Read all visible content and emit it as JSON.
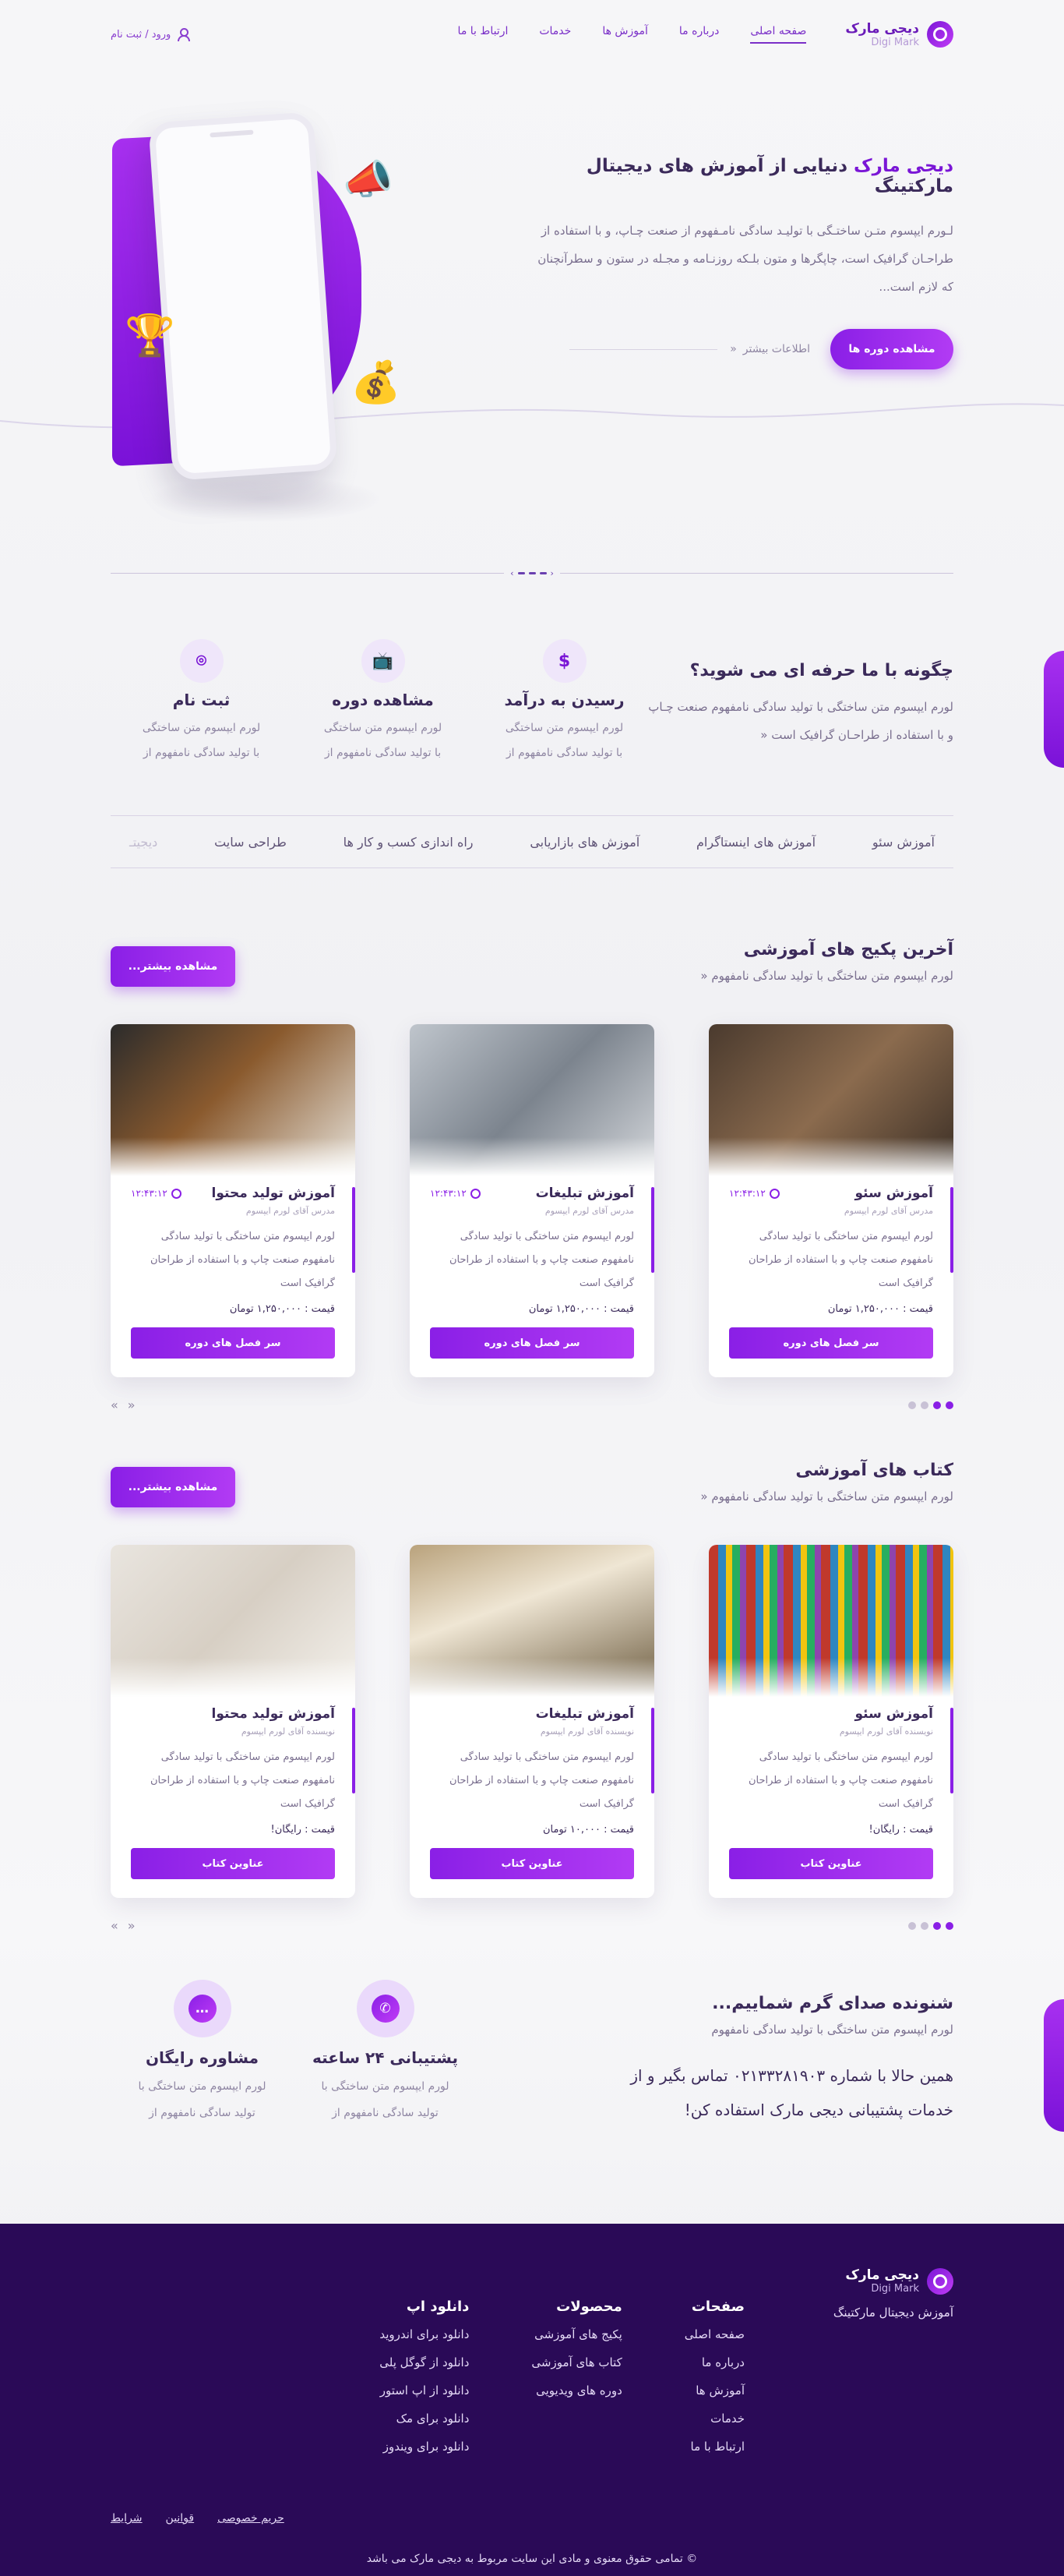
{
  "brand": {
    "name_fa": "دیجی مارک",
    "name_en": "Digi Mark"
  },
  "nav": {
    "items": [
      "صفحه اصلی",
      "درباره ما",
      "آموزش ها",
      "خدمات",
      "ارتباط با ما"
    ],
    "login": "ورود / ثبت نام"
  },
  "hero": {
    "brand": "دیجی مارک",
    "title": "دنیایی از آموزش های دیجیتال مارکتینگ",
    "desc": "لـورم ایپسوم متـن ساختـگی با تولیـد سادگی نامـفهوم از صنعت چـاپ، و با استفاده از طراحـان گرافیک است، چاپگرها و متون بلـکه روزنـامه و مجـله در ستون و سطرآنچنان که لازم است...",
    "cta": "مشاهده دوره ها",
    "more": "اطلاعات بیشتر"
  },
  "how": {
    "title": "چگونه با ما حرفه ای می شوید؟",
    "desc": "لورم ایپسوم متن ساختگی با تولید سادگی نامفهوم صنعت چـاپ و با استفاده از طراحـان گرافیک است",
    "steps": [
      {
        "title": "ثبت نام",
        "l1": "لورم ایپسوم متن ساختگی",
        "l2": "با تولید سادگی نامفهوم از",
        "icon": "user-scan-icon"
      },
      {
        "title": "مشاهده دوره",
        "l1": "لورم ایپسوم متن ساختگی",
        "l2": "با تولید سادگی نامفهوم از",
        "icon": "tv-icon"
      },
      {
        "title": "رسیدن به درآمد",
        "l1": "لورم ایپسوم متن ساختگی",
        "l2": "با تولید سادگی نامفهوم از",
        "icon": "dollar-icon"
      }
    ]
  },
  "tabs": [
    "آموزش سئو",
    "آموزش های اینستاگرام",
    "آموزش های بازاریابی",
    "راه اندازی کسب و کار ها",
    "طراحی سایت",
    "دیجیتـ"
  ],
  "packages": {
    "title": "آخرین پکیج های آموزشی",
    "sub": "لورم ایپسوم متن ساختگی با تولید سادگی نامفهوم",
    "more": "مشاهده بیشتر...",
    "cards": [
      {
        "title": "آموزش سئو",
        "time": "۱۲:۴۳:۱۲",
        "sub": "مدرس آقای لورم ایپسوم",
        "desc": "لورم ایپسوم متن ساختگی با تولید سادگی نامفهوم صنعت چاپ و با استفاده از طراحان گرافیک است",
        "price": "قیمت : ۱,۲۵۰,۰۰۰ تومان",
        "btn": "سر فصل های دوره"
      },
      {
        "title": "آموزش تبلیغات",
        "time": "۱۲:۴۳:۱۲",
        "sub": "مدرس آقای لورم ایپسوم",
        "desc": "لورم ایپسوم متن ساختگی با تولید سادگی نامفهوم صنعت چاپ و با استفاده از طراحان گرافیک است",
        "price": "قیمت : ۱,۲۵۰,۰۰۰ تومان",
        "btn": "سر فصل های دوره"
      },
      {
        "title": "آموزش تولید محتوا",
        "time": "۱۲:۴۳:۱۲",
        "sub": "مدرس آقای لورم ایپسوم",
        "desc": "لورم ایپسوم متن ساختگی با تولید سادگی نامفهوم صنعت چاپ و با استفاده از طراحان گرافیک است",
        "price": "قیمت : ۱,۲۵۰,۰۰۰ تومان",
        "btn": "سر فصل های دوره"
      }
    ]
  },
  "books": {
    "title": "کتاب های آموزشی",
    "sub": "لورم ایپسوم متن ساختگی با تولید سادگی نامفهوم",
    "more": "مشاهده بیشتر...",
    "cards": [
      {
        "title": "آموزش سئو",
        "sub": "نویسنده آقای لورم ایپسوم",
        "desc": "لورم ایپسوم متن ساختگی با تولید سادگی نامفهوم صنعت چاپ و با استفاده از طراحان گرافیک است",
        "price": "قیمت : رایگان!",
        "btn": "عناوین کتاب"
      },
      {
        "title": "آموزش تبلیغات",
        "sub": "نویسنده آقای لورم ایپسوم",
        "desc": "لورم ایپسوم متن ساختگی با تولید سادگی نامفهوم صنعت چاپ و با استفاده از طراحان گرافیک است",
        "price": "قیمت : ۱۰,۰۰۰ تومان",
        "btn": "عناوین کتاب"
      },
      {
        "title": "آموزش تولید محتوا",
        "sub": "نویسنده آقای لورم ایپسوم",
        "desc": "لورم ایپسوم متن ساختگی با تولید سادگی نامفهوم صنعت چاپ و با استفاده از طراحان گرافیک است",
        "price": "قیمت : رایگان!",
        "btn": "عناوین کتاب"
      }
    ]
  },
  "support": {
    "title": "شنونده صدای گرم شماییم...",
    "sub": "لورم ایپسوم متن ساختگی با تولید سادگی نامفهوم",
    "line1": "همین حالا با شماره ۰۲۱۳۳۲۸۱۹۰۳ تماس بگیر و از",
    "line2": "خدمات پشتیبانی دیجی مارک استفاده کن!",
    "items": [
      {
        "title": "مشاوره رایگان",
        "l1": "لورم ایپسوم متن ساختگی با",
        "l2": "تولید سادگی نامفهوم از"
      },
      {
        "title": "پشتیبانی ۲۴ ساعته",
        "l1": "لورم ایپسوم متن ساختگی با",
        "l2": "تولید سادگی نامفهوم از"
      }
    ]
  },
  "footer": {
    "tagline": "آموزش دیجیتال مارکتینگ",
    "cols": [
      {
        "title": "صفحات",
        "links": [
          "صفحه اصلی",
          "درباره ما",
          "آموزش ها",
          "خدمات",
          "ارتباط با ما"
        ]
      },
      {
        "title": "محصولات",
        "links": [
          "پکیج های آموزشی",
          "کتاب های آموزشی",
          "دوره های ویدیویی"
        ]
      },
      {
        "title": "دانلود اپ",
        "links": [
          "دانلود برای اندروید",
          "دانلود از گوگل پلی",
          "دانلود از اپ استور",
          "دانلود برای مک",
          "دانلود برای ویندوز"
        ]
      }
    ],
    "legal": [
      "حریم خصوصی",
      "قوانین",
      "شرایط"
    ],
    "copyright": "© تمامی حقوق معنوی و مادی این سایت مربوط به دیجی مارک می باشد"
  },
  "colors": {
    "primary": "#8a1fe6",
    "footer_bg": "#2a0a57",
    "text": "#3b2a5a"
  }
}
